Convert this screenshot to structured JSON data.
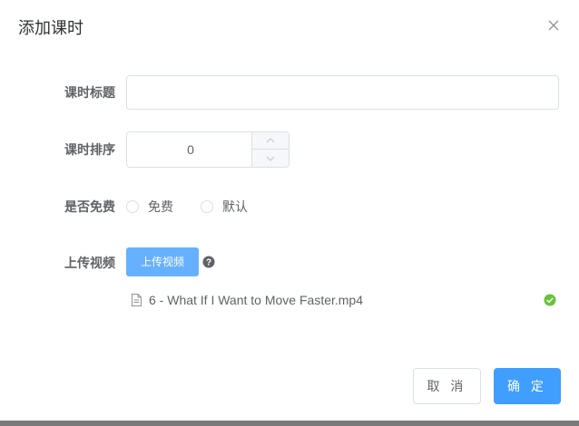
{
  "dialog": {
    "title": "添加课时",
    "close_icon": "close-icon"
  },
  "form": {
    "title_label": "课时标题",
    "title_value": "",
    "title_placeholder": "",
    "sort_label": "课时排序",
    "sort_value": "0",
    "free_label": "是否免费",
    "free_options": [
      "免费",
      "默认"
    ],
    "upload_label": "上传视频",
    "upload_button": "上传视频",
    "help_icon": "question-circle-icon",
    "file": {
      "name": "6 - What If I Want to Move Faster.mp4",
      "icon": "document-icon",
      "status_icon": "success-check-icon"
    }
  },
  "footer": {
    "cancel_label": "取 消",
    "confirm_label": "确 定"
  },
  "colors": {
    "primary": "#409eff",
    "upload_button": "#66b1ff",
    "success": "#67c23a",
    "border": "#dcdfe6",
    "text": "#606266",
    "title": "#303133"
  }
}
